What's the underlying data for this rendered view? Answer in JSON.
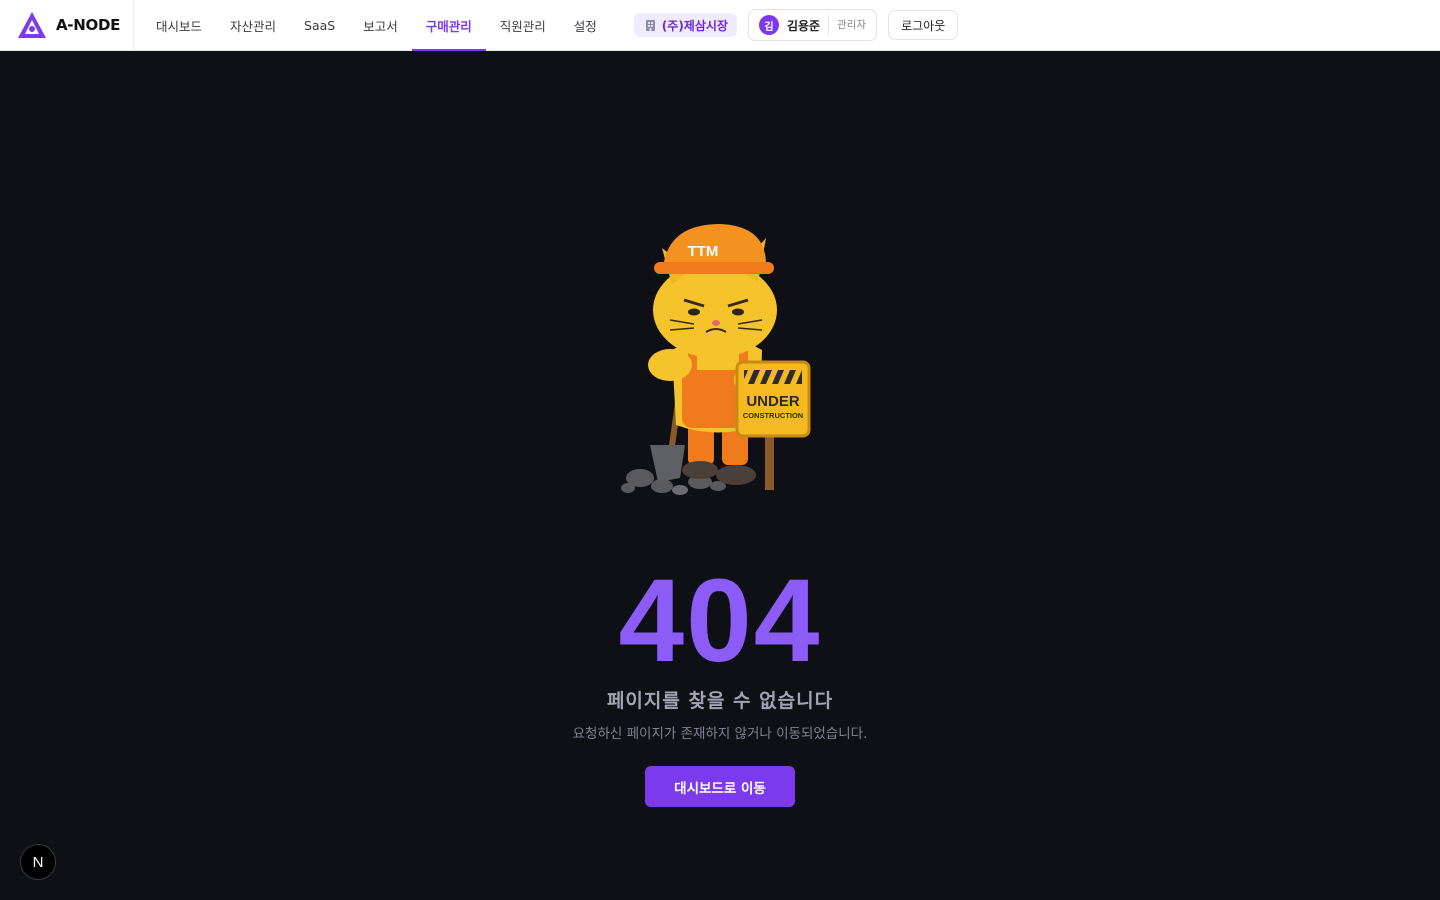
{
  "header": {
    "brand": "A-NODE",
    "nav": [
      {
        "label": "대시보드",
        "active": false
      },
      {
        "label": "자산관리",
        "active": false
      },
      {
        "label": "SaaS",
        "active": false
      },
      {
        "label": "보고서",
        "active": false
      },
      {
        "label": "구매관리",
        "active": true
      },
      {
        "label": "직원관리",
        "active": false
      },
      {
        "label": "설정",
        "active": false
      }
    ],
    "org": "(주)제삼시장",
    "user": {
      "initial": "김",
      "name": "김용준",
      "role": "관리자"
    },
    "logout": "로그아웃"
  },
  "illustration": {
    "helmet_text": "TTM",
    "sign_line1": "UNDER",
    "sign_line2": "CONSTRUCTION"
  },
  "error": {
    "code": "404",
    "title": "페이지를 찾을 수 없습니다",
    "description": "요청하신 페이지가 존재하지 않거나 이동되었습니다.",
    "button": "대시보드로 이동"
  },
  "dev_badge": "N",
  "colors": {
    "accent": "#7c3aed",
    "code": "#8b5cf6",
    "background": "#0f1016"
  },
  "icons": {
    "brand": "triangle-logo-icon",
    "org": "building-icon",
    "dev": "nextjs-icon"
  }
}
